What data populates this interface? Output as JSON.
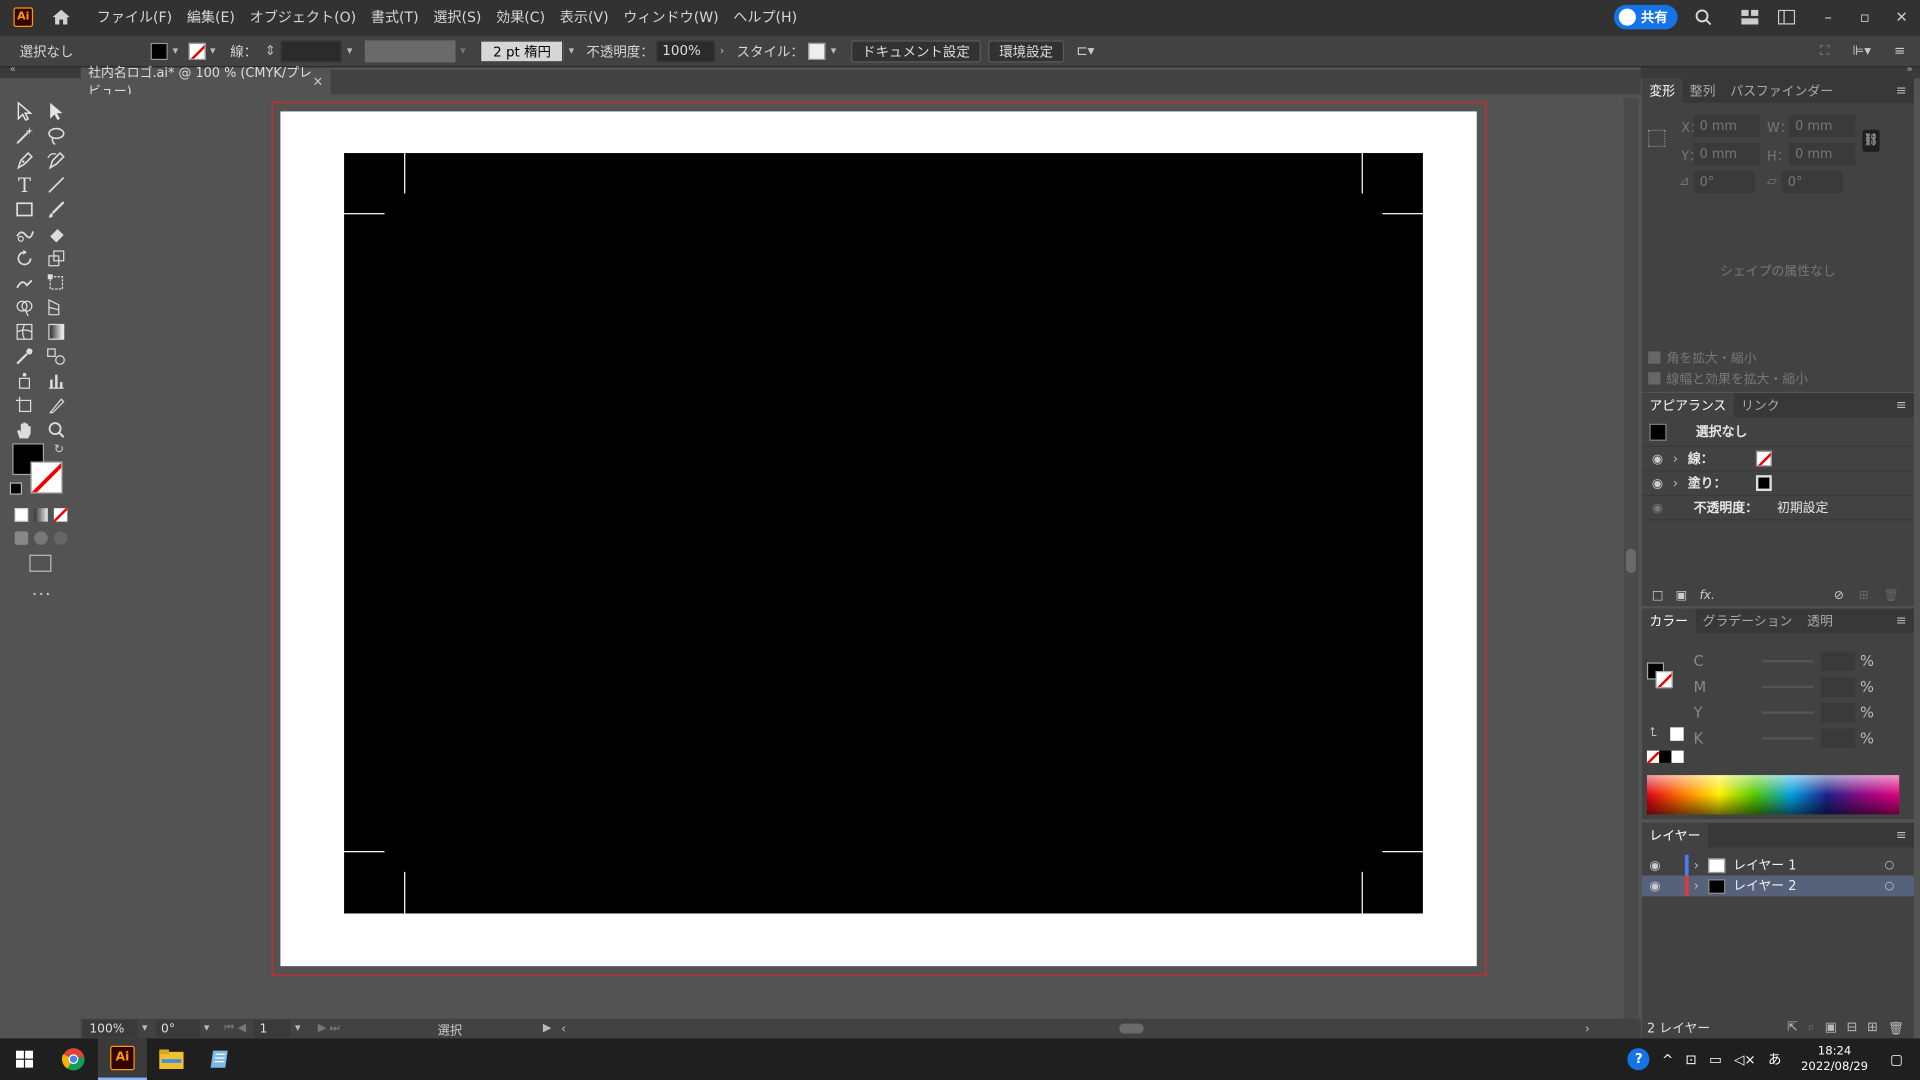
{
  "menubar": {
    "app_logo": "Ai",
    "items": [
      "ファイル(F)",
      "編集(E)",
      "オブジェクト(O)",
      "書式(T)",
      "選択(S)",
      "効果(C)",
      "表示(V)",
      "ウィンドウ(W)",
      "ヘルプ(H)"
    ],
    "share_label": "共有"
  },
  "controlbar": {
    "selection": "選択なし",
    "stroke_label": "線：",
    "brush": "2 pt 楕円",
    "opacity_label": "不透明度：",
    "opacity_value": "100%",
    "style_label": "スタイル：",
    "doc_setup": "ドキュメント設定",
    "prefs": "環境設定"
  },
  "document": {
    "tab_title": "社内名ロゴ.ai* @ 100 % (CMYK/プレビュー)",
    "close": "×"
  },
  "status": {
    "zoom": "100%",
    "rotation": "0°",
    "page": "1",
    "tool": "選択"
  },
  "transform_panel": {
    "tabs": [
      "変形",
      "整列",
      "パスファインダー"
    ],
    "x_label": "X：",
    "x": "0 mm",
    "y_label": "Y：",
    "y": "0 mm",
    "w_label": "W：",
    "w": "0 mm",
    "h_label": "H：",
    "h": "0 mm",
    "angle": "0°",
    "shear": "0°",
    "no_shape": "シェイプの属性なし",
    "scale_corners": "角を拡大・縮小",
    "scale_strokes": "線幅と効果を拡大・縮小"
  },
  "appearance_panel": {
    "tabs": [
      "アピアランス",
      "リンク"
    ],
    "title": "選択なし",
    "stroke_label": "線：",
    "fill_label": "塗り：",
    "opacity_label": "不透明度：",
    "opacity_value": "初期設定",
    "fx": "fx."
  },
  "color_panel": {
    "tabs": [
      "カラー",
      "グラデーション",
      "透明"
    ],
    "channels": [
      "C",
      "M",
      "Y",
      "K"
    ],
    "percent": "%"
  },
  "layers_panel": {
    "title": "レイヤー",
    "layers": [
      "レイヤー 1",
      "レイヤー 2"
    ],
    "footer": "2 レイヤー"
  },
  "taskbar": {
    "time": "18:24",
    "date": "2022/08/29",
    "ime": "あ"
  },
  "colors": {
    "accent": "#1473e6",
    "artboard_border": "#d9252a",
    "layer1": "#4b7cf7",
    "layer2": "#e03a3a"
  }
}
